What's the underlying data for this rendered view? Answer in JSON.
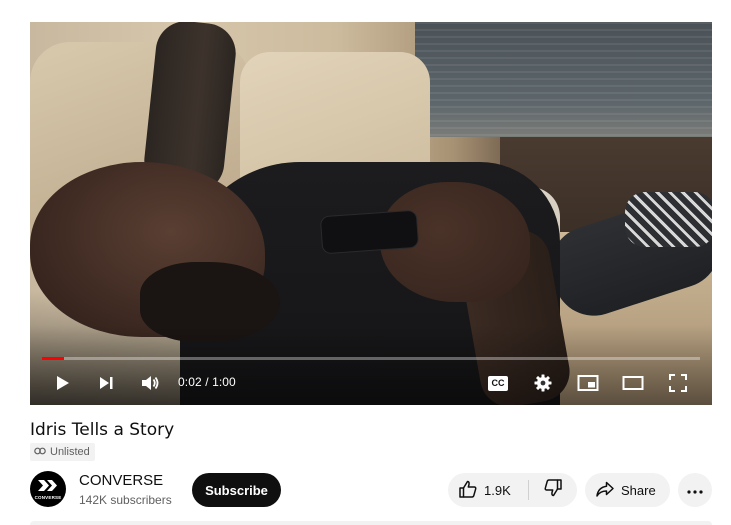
{
  "video": {
    "current_time": "0:02",
    "separator": " / ",
    "duration": "1:00",
    "progress_fraction": 0.033
  },
  "controls": {
    "play_icon": "play-icon",
    "next_icon": "skip-next-icon",
    "volume_icon": "volume-icon",
    "captions_label": "CC",
    "settings_icon": "gear-icon",
    "miniplayer_icon": "miniplayer-icon",
    "theater_icon": "theater-mode-icon",
    "fullscreen_icon": "fullscreen-icon"
  },
  "info": {
    "title": "Idris Tells a Story",
    "visibility": "Unlisted",
    "visibility_icon": "link-icon"
  },
  "channel": {
    "name": "CONVERSE",
    "subscribers": "142K subscribers",
    "avatar_text": "CONVERSE",
    "subscribe_label": "Subscribe"
  },
  "actions": {
    "like_count": "1.9K",
    "share_label": "Share",
    "more_icon": "more-horizontal-icon"
  },
  "colors": {
    "progress": "#ff0000",
    "subscribe_bg": "#0f0f0f",
    "pill_bg": "#f2f2f2"
  }
}
